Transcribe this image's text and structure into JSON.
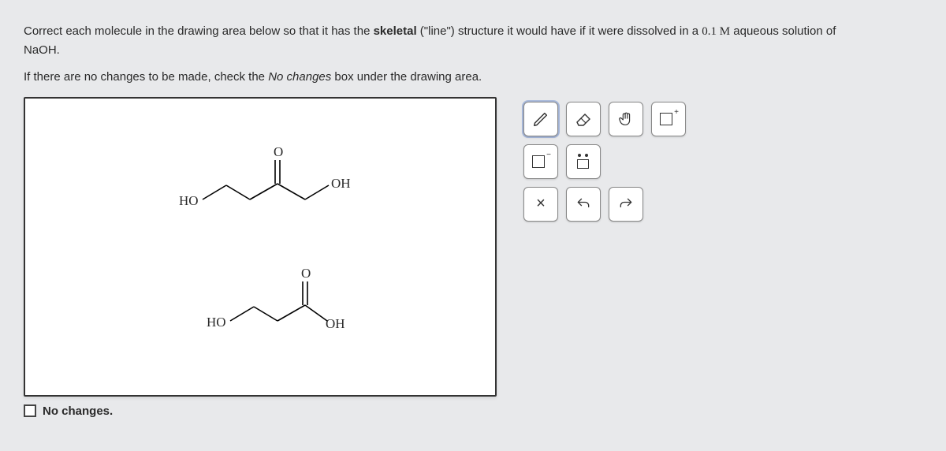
{
  "prompt": {
    "line1a": "Correct each molecule in the drawing area below so that it has the ",
    "bold": "skeletal",
    "paren": " (\"line\") structure it would have if it were dissolved in a ",
    "conc": "0.1 M",
    "line1b": " aqueous solution of ",
    "formula": "NaOH.",
    "line2a": "If there are no changes to be made, check the ",
    "italic": "No changes",
    "line2b": " box under the drawing area."
  },
  "molecules": {
    "m1": {
      "left_label": "HO",
      "top_label": "O",
      "right_label": "OH"
    },
    "m2": {
      "left_label": "HO",
      "top_label": "O",
      "right_label": "OH"
    }
  },
  "no_changes_label": "No changes.",
  "toolbox": {
    "pencil": "pencil-icon",
    "eraser": "eraser-icon",
    "hand": "hand-icon",
    "plus_charge": "+",
    "minus_charge": "−",
    "lone_pair": "lone-pair",
    "clear": "×",
    "undo": "↶",
    "redo": "↷"
  }
}
